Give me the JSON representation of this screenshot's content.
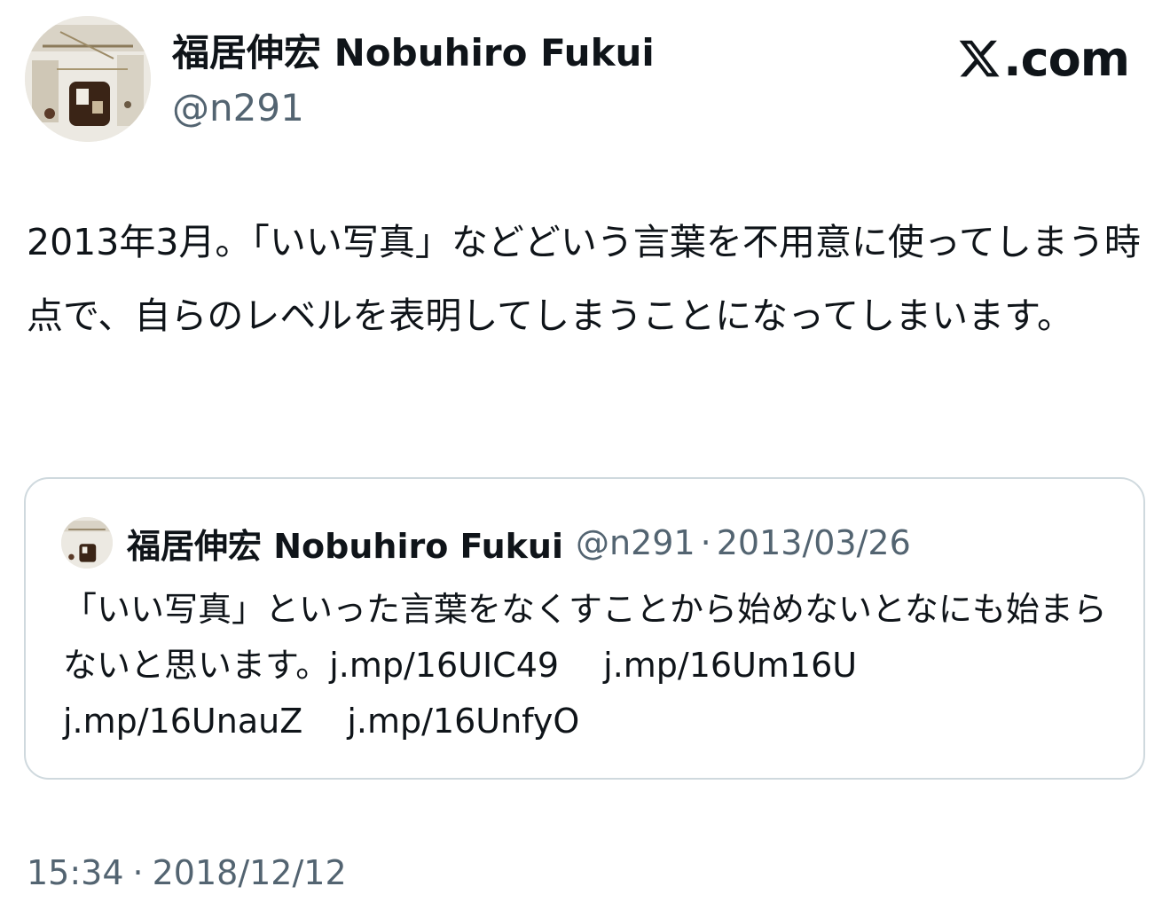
{
  "author": {
    "display_name": "福居伸宏 Nobuhiro Fukui",
    "handle": "@n291",
    "avatar_icon": "profile-photo-icon"
  },
  "brand": {
    "label": ".com",
    "icon": "x-logo-icon"
  },
  "tweet": {
    "text": "2013年3月。「いい写真」などどいう言葉を不用意に使ってしまう時点で、自らのレベルを表明してしまうことになってしまいます。"
  },
  "quote": {
    "display_name": "福居伸宏 Nobuhiro Fukui",
    "handle": "@n291",
    "separator": "·",
    "date": "2013/03/26",
    "text": "「いい写真」といった言葉をなくすことから始めないとなにも始まらないと思います。",
    "links": [
      "j.mp/16UIC49",
      "j.mp/16Um16U",
      "j.mp/16UnauZ",
      "j.mp/16UnfyO"
    ]
  },
  "footer": {
    "time": "15:34",
    "separator": "·",
    "date": "2018/12/12"
  },
  "colors": {
    "text_primary": "#0f1419",
    "text_secondary": "#536471",
    "border": "#cfd9de",
    "background": "#ffffff"
  }
}
